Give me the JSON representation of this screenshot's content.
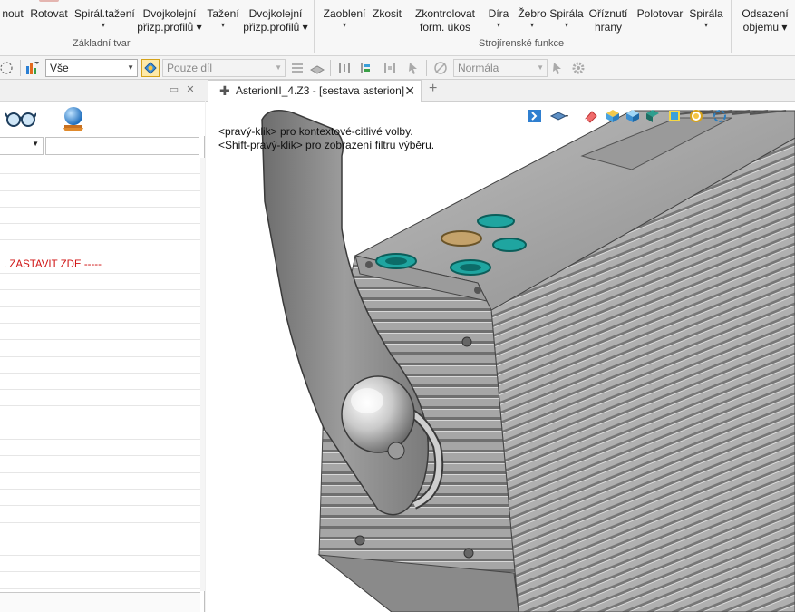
{
  "ribbon": {
    "basic_shape": {
      "group_label": "Základní tvar",
      "buttons": [
        {
          "label": "nout",
          "dropdown": false
        },
        {
          "label": "Rotovat",
          "dropdown": false
        },
        {
          "label": "Spirál.tažení",
          "dropdown": true
        },
        {
          "label": "Dvojkolejní přizp.profilů",
          "line1": "Dvojkolejní",
          "line2": "přizp.profilů ▾"
        },
        {
          "label": "Tažení",
          "dropdown": true
        },
        {
          "label": "Dvojkolejní přizp.profilů",
          "line1": "Dvojkolejní",
          "line2": "přizp.profilů ▾"
        }
      ]
    },
    "engineering": {
      "group_label": "Strojírenské funkce",
      "buttons": [
        {
          "label": "Zaoblení",
          "dropdown": true
        },
        {
          "label": "Zkosit",
          "dropdown": false
        },
        {
          "label": "Zkontrolovat form. úkos",
          "line1": "Zkontrolovat",
          "line2": "form. úkos"
        },
        {
          "label": "Díra",
          "dropdown": true
        },
        {
          "label": "Žebro",
          "dropdown": true
        },
        {
          "label": "Spirála",
          "dropdown": true
        },
        {
          "label": "Oříznutí hrany",
          "line1": "Oříznutí",
          "line2": "hrany"
        },
        {
          "label": "Polotovar",
          "dropdown": false
        },
        {
          "label": "Spirála",
          "dropdown": true
        }
      ]
    },
    "offset": {
      "line1": "Odsazení",
      "line2": "objemu ▾"
    }
  },
  "toolbar": {
    "filter_value": "Vše",
    "selection_value": "Pouze díl",
    "normal_value": "Normála"
  },
  "left_panel": {
    "tree_rows": [
      "",
      "",
      "",
      "",
      "",
      "",
      ". ZASTAVIT ZDE -----",
      "",
      "",
      "",
      "",
      "",
      "",
      "",
      "",
      "",
      "",
      "",
      "",
      "",
      "",
      "",
      "",
      "",
      "",
      ""
    ]
  },
  "document": {
    "tab_title": "AsterionII_4.Z3 - [sestava asterion]",
    "hint_line1": "<pravý-klik> pro kontextové-citlivé volby.",
    "hint_line2": "<Shift-pravý-klik> pro zobrazení filtru výběru."
  },
  "icons": [
    "glasses-icon",
    "globe-icon",
    "filter-icon",
    "select-mode-icon",
    "pin-icon",
    "close-icon",
    "add-tab-icon",
    "render-icon",
    "eraser-icon",
    "cube-icon",
    "dropdown-arrow-icon"
  ],
  "colors": {
    "stop_marker": "#d01515",
    "ribbon_bg": "#f7f7f7",
    "viewport_bg": "#ffffff",
    "model_gray": "#8f8f8f",
    "connector_teal": "#1fa5a0"
  }
}
